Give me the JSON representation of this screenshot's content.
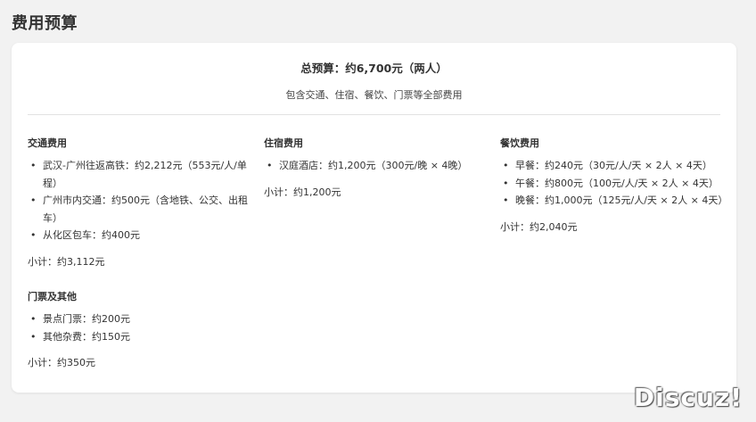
{
  "page_title": "费用预算",
  "card": {
    "total": "总预算：约6,700元（两人）",
    "subtitle": "包含交通、住宿、餐饮、门票等全部费用"
  },
  "sections": {
    "transport": {
      "title": "交通费用",
      "items": [
        "武汉-广州往返高铁：约2,212元（553元/人/单程）",
        "广州市内交通：约500元（含地铁、公交、出租车）",
        "从化区包车：约400元"
      ],
      "subtotal": "小计：约3,112元"
    },
    "lodging": {
      "title": "住宿费用",
      "items": [
        "汉庭酒店：约1,200元（300元/晚 × 4晚）"
      ],
      "subtotal": "小计：约1,200元"
    },
    "food": {
      "title": "餐饮费用",
      "items": [
        "早餐：约240元（30元/人/天 × 2人 × 4天）",
        "午餐：约800元（100元/人/天 × 2人 × 4天）",
        "晚餐：约1,000元（125元/人/天 × 2人 × 4天）"
      ],
      "subtotal": "小计：约2,040元"
    },
    "tickets": {
      "title": "门票及其他",
      "items": [
        "景点门票：约200元",
        "其他杂费：约150元"
      ],
      "subtotal": "小计：约350元"
    }
  },
  "bullet": "•",
  "watermark": "Discuz!"
}
